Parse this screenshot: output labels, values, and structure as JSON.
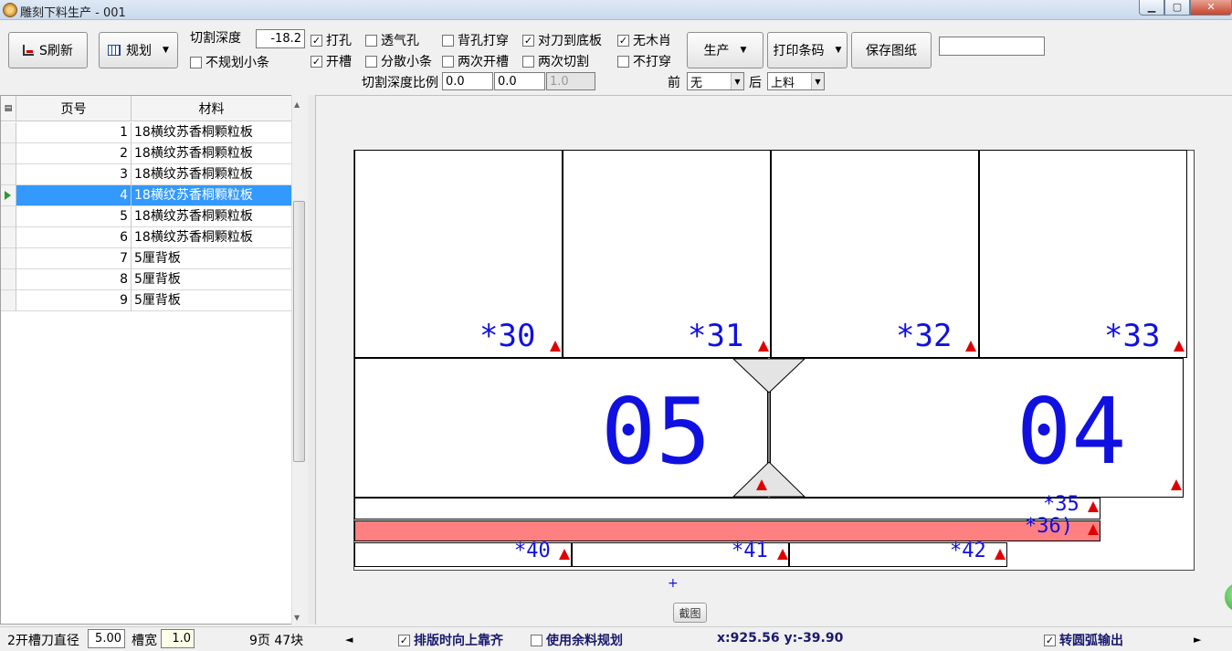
{
  "window": {
    "title": "雕刻下料生产 - 001",
    "min_label": "▁",
    "max_label": "▢",
    "close_label": "✕"
  },
  "toolbar": {
    "refresh_label": "S刷新",
    "plan_label": "规划",
    "cut_depth_label": "切割深度",
    "cut_depth_value": "-18.2",
    "produce_label": "生产",
    "print_barcode_label": "打印条码",
    "save_drawing_label": "保存图纸",
    "search_value": "",
    "depth_ratio_label": "切割深度比例",
    "depth_ratio_values": [
      "0.0",
      "0.0",
      "1.0"
    ],
    "front_label": "前",
    "front_value": "无",
    "back_label": "后",
    "back_value": "上料",
    "options": {
      "no_plan_strip": {
        "label": "不规划小条",
        "checked": false
      },
      "drill": {
        "label": "打孔",
        "checked": true
      },
      "vent_hole": {
        "label": "透气孔",
        "checked": false
      },
      "back_hole_through": {
        "label": "背孔打穿",
        "checked": false
      },
      "knife_to_bottom": {
        "label": "对刀到底板",
        "checked": true
      },
      "no_wood_chips": {
        "label": "无木肖",
        "checked": true
      },
      "slot": {
        "label": "开槽",
        "checked": true
      },
      "scatter_strip": {
        "label": "分散小条",
        "checked": false
      },
      "double_slot": {
        "label": "两次开槽",
        "checked": false
      },
      "double_cut": {
        "label": "两次切割",
        "checked": false
      },
      "no_through": {
        "label": "不打穿",
        "checked": false
      }
    }
  },
  "grid": {
    "headers": [
      "页号",
      "材料"
    ],
    "rows": [
      {
        "page": "1",
        "material": "18横纹苏香桐颗粒板"
      },
      {
        "page": "2",
        "material": "18横纹苏香桐颗粒板"
      },
      {
        "page": "3",
        "material": "18横纹苏香桐颗粒板"
      },
      {
        "page": "4",
        "material": "18横纹苏香桐颗粒板"
      },
      {
        "page": "5",
        "material": "18横纹苏香桐颗粒板"
      },
      {
        "page": "6",
        "material": "18横纹苏香桐颗粒板"
      },
      {
        "page": "7",
        "material": "5厘背板"
      },
      {
        "page": "8",
        "material": "5厘背板"
      },
      {
        "page": "9",
        "material": "5厘背板"
      }
    ],
    "selected_page": "4"
  },
  "drawing": {
    "parts": [
      "*30",
      "*31",
      "*32",
      "*33",
      "05",
      "04",
      "*35",
      "*36)",
      "*40",
      "*41",
      "*42"
    ],
    "origin_mark": "+",
    "screenshot_button": "截图",
    "highlight_color": "#ff8080",
    "label_color": "#1010e0"
  },
  "status": {
    "slot_knife_label": "2开槽刀直径",
    "slot_knife_value": "5.00",
    "slot_width_label": "槽宽",
    "slot_width_value": "1.0",
    "summary": "9页 47块",
    "left_arrow": "◄",
    "align_top_label": "排版时向上靠齐",
    "align_top_checked": true,
    "use_remnant_label": "使用余料规划",
    "use_remnant_checked": false,
    "coords": "x:925.56 y:-39.90",
    "arc_output_label": "转圆弧输出",
    "arc_output_checked": true,
    "right_arrow": "►"
  }
}
